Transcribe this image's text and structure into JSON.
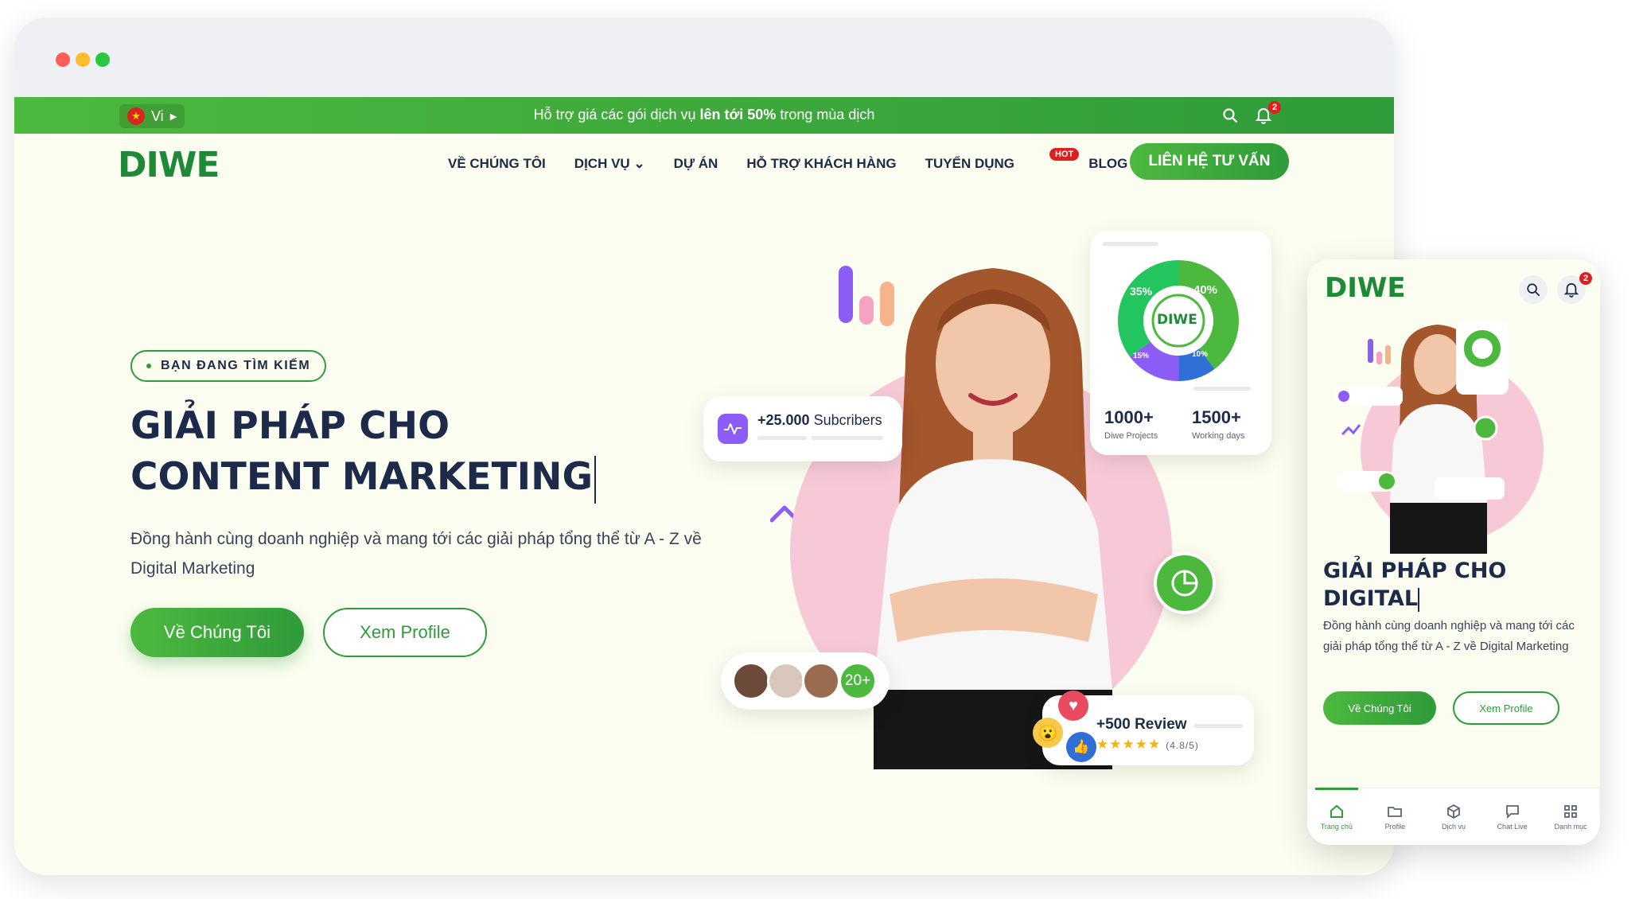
{
  "window": {
    "traffic_lights": [
      "close",
      "minimize",
      "maximize"
    ]
  },
  "topbar": {
    "lang_label": "Vi",
    "promo_prefix": "Hỗ trợ giá các gói dịch vụ ",
    "promo_bold": "lên tới 50%",
    "promo_suffix": " trong mùa dịch",
    "notification_count": "2"
  },
  "nav": {
    "logo": "DIWE",
    "items": [
      {
        "label": "VỀ CHÚNG TÔI"
      },
      {
        "label": "DỊCH VỤ ⌄"
      },
      {
        "label": "DỰ ÁN"
      },
      {
        "label": "HỖ TRỢ KHÁCH HÀNG"
      },
      {
        "label": "TUYỂN DỤNG"
      },
      {
        "label": "BLOG"
      }
    ],
    "hot_badge": "HOT",
    "cta_label": "LIÊN HỆ TƯ VẤN"
  },
  "hero": {
    "tag": "BẠN ĐANG TÌM KIẾM",
    "title_line1": "GIẢI PHÁP CHO",
    "title_line2": "CONTENT MARKETING",
    "description": "Đồng hành cùng doanh nghiệp và mang tới các giải pháp tổng thể từ A - Z về Digital Marketing",
    "primary_button": "Về Chúng Tôi",
    "secondary_button": "Xem Profile"
  },
  "cards": {
    "subscribers_bold": "+25.000",
    "subscribers_label": " Subcribers",
    "stat1_value": "1000+",
    "stat1_label": "Diwe Projects",
    "stat2_value": "1500+",
    "stat2_label": "Working days",
    "donut_pct_left": "35%",
    "donut_pct_right": "40%",
    "donut_pct_bottom_left": "15%",
    "donut_pct_bottom_right": "10%",
    "donut_logo": "DIWE",
    "people_more": "20+",
    "review_label": "+500 Review",
    "review_score": "(4.8/5)",
    "stars": "★★★★★"
  },
  "mobile": {
    "logo": "DIWE",
    "notification_count": "2",
    "title_line1": "GIẢI PHÁP CHO",
    "title_line2": "DIGITAL",
    "description": "Đồng hành cùng doanh nghiệp và mang tới các giải pháp tổng thể từ A - Z về Digital Marketing",
    "primary_button": "Về Chúng Tôi",
    "secondary_button": "Xem Profile",
    "tabs": [
      {
        "label": "Trang chủ",
        "icon": "home-icon"
      },
      {
        "label": "Profile",
        "icon": "folder-icon"
      },
      {
        "label": "Dịch vụ",
        "icon": "box-icon"
      },
      {
        "label": "Chat Live",
        "icon": "chat-icon"
      },
      {
        "label": "Danh mục",
        "icon": "grid-icon"
      }
    ]
  },
  "colors": {
    "brand_green": "#2f9b3a",
    "light_green": "#4db83e",
    "accent_pink": "#f7c9d6",
    "accent_purple": "#8b5cf6",
    "hot_red": "#e11d1d"
  }
}
